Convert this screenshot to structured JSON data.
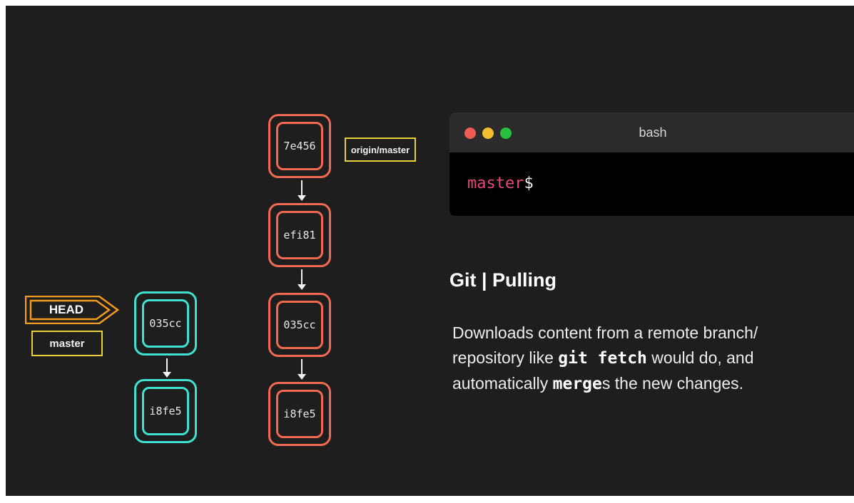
{
  "graph": {
    "remote_commits": [
      "7e456",
      "efi81",
      "035cc",
      "i8fe5"
    ],
    "local_commits": [
      "035cc",
      "i8fe5"
    ],
    "remote_branch_label": "origin/master",
    "head_label": "HEAD",
    "local_branch_label": "master"
  },
  "terminal": {
    "title": "bash",
    "prompt_branch": "master",
    "prompt_symbol": "$",
    "colors": {
      "close": "#ee5c53",
      "minimize": "#f4bc2f",
      "zoom": "#27c13f",
      "prompt": "#e8467c"
    }
  },
  "text": {
    "heading": "Git | Pulling",
    "desc_line1": "Downloads content from a remote branch/",
    "desc_line2_pre": "repository like ",
    "desc_line2_code": "git fetch",
    "desc_line2_post": " would do, and",
    "desc_line3_pre": "automatically ",
    "desc_line3_code": "merge",
    "desc_line3_post": "s the new changes."
  },
  "colors": {
    "background": "#1e1e1e",
    "remote_commit": "#f26a52",
    "local_commit": "#3fe2d2",
    "head": "#f29a1e",
    "branch_tag": "#e7d03a"
  }
}
